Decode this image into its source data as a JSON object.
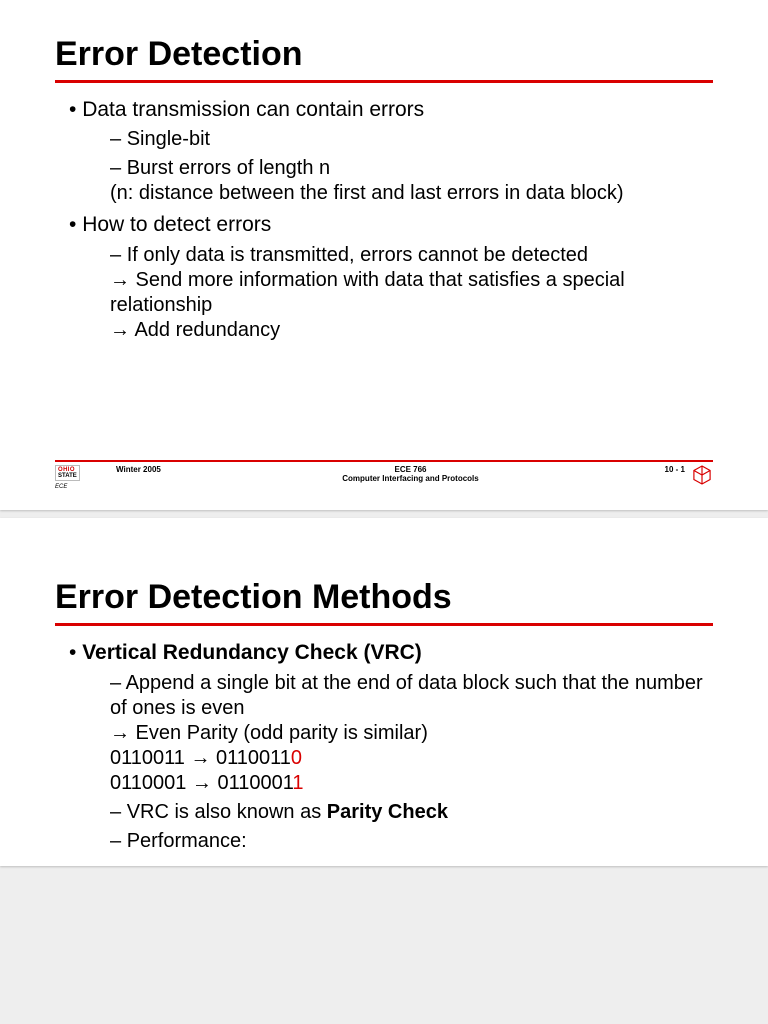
{
  "slide1": {
    "title": "Error Detection",
    "b1": "Data transmission can contain errors",
    "b1a": "Single-bit",
    "b1b": "Burst errors of length n",
    "b1b2": "(n: distance between the first and last errors in data block)",
    "b2": "How to detect errors",
    "b2a": "If only data is transmitted, errors cannot be detected",
    "b2a2": "→ Send more information with data that satisfies a special relationship",
    "b2a3": "→ Add redundancy"
  },
  "slide2": {
    "title": "Error Detection Methods",
    "b1_pre": "",
    "b1": "Vertical Redundancy Check (VRC)",
    "b1a": "Append a single bit at the end of data block such that the number of ones is even",
    "b1a2": "→ Even Parity (odd parity is similar)",
    "ex1a": "0110011 → 0110011",
    "ex1b": "0",
    "ex2a": "0110001 → 0110001",
    "ex2b": "1",
    "b1c_pre": "VRC is also known as ",
    "b1c_bold": "Parity Check",
    "b1d": "Performance:"
  },
  "footer": {
    "term": "Winter 2005",
    "course": "ECE 766",
    "subtitle": "Computer Interfacing and Protocols",
    "page": "10 -   1",
    "ece": "ECE",
    "osu_top": "OHIO",
    "osu_bottom": "STATE"
  }
}
